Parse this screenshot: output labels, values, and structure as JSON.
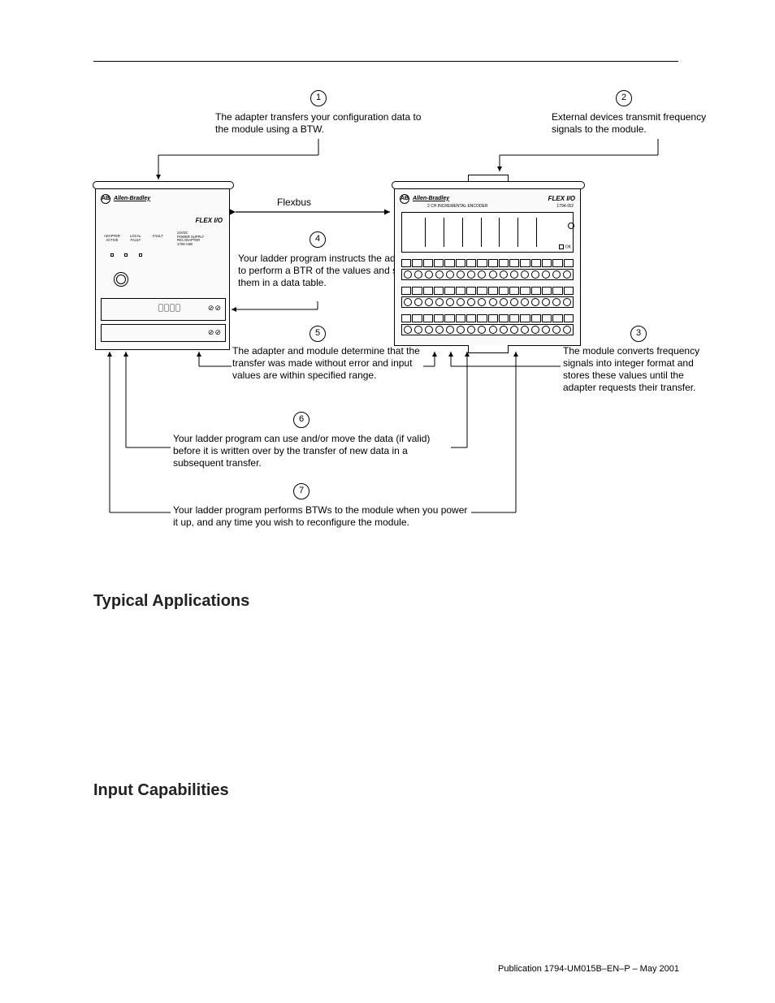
{
  "diagram": {
    "flexbus_label": "Flexbus",
    "adapter": {
      "brand": "Allen-Bradley",
      "flex": "FLEX I/O",
      "leds": {
        "adapter": "ADAPTER\nACTIVE",
        "local": "LOCAL\nFAULT",
        "fault": "FAULT"
      },
      "pwr": "24VDC\nPOWER SUPPLY\nRIO ADAPTER\n1794-ASB",
      "slot_sym": "⊘⊘"
    },
    "module": {
      "brand": "Allen-Bradley",
      "flex": "FLEX I/O",
      "sub": "2 CH INCREMENTAL ENCODER",
      "cat": "1794-ID2",
      "ok": "OK"
    },
    "callouts": {
      "c1": {
        "num": "1",
        "text": "The adapter transfers your configuration data to the module using a BTW."
      },
      "c2": {
        "num": "2",
        "text": "External devices transmit frequency signals to the module."
      },
      "c3": {
        "num": "3",
        "text": "The module converts frequency signals into integer format and stores these values until the adapter requests their transfer."
      },
      "c4": {
        "num": "4",
        "text": "Your ladder program instructs the adapter to perform a BTR of the values and stores them in a data table."
      },
      "c5": {
        "num": "5",
        "text": "The adapter and module determine that the transfer was made without error and input values are within specified range."
      },
      "c6": {
        "num": "6",
        "text": "Your ladder program can use and/or move the data (if valid) before it is written over by the transfer of new data in a subsequent transfer."
      },
      "c7": {
        "num": "7",
        "text": "Your ladder program performs BTWs to the module when you power it up, and any time you wish to reconfigure the module."
      }
    }
  },
  "sections": {
    "typical": "Typical Applications",
    "input": "Input Capabilities"
  },
  "footer": "Publication 1794-UM015B–EN–P – May 2001"
}
